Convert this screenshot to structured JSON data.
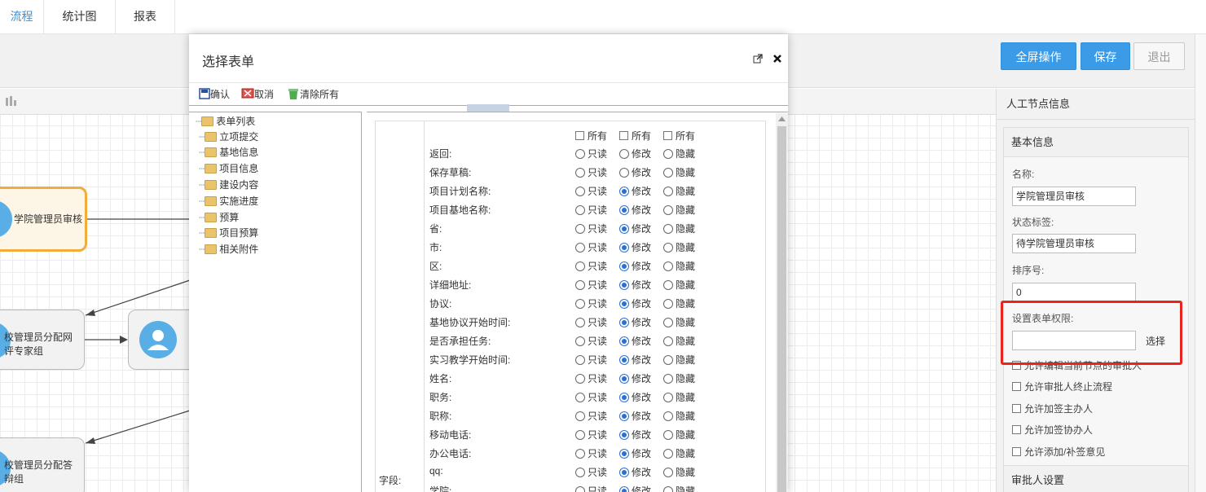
{
  "tabs": [
    "流程",
    "统计图",
    "报表"
  ],
  "toolbar": {
    "fullscreen": "全屏操作",
    "save": "保存",
    "exit": "退出"
  },
  "nodes": {
    "college": "学院管理员审核",
    "school1_line1": "校管理员分配网",
    "school1_line2": "评专家组",
    "school2_line1": "校管理员分配答",
    "school2_line2": "辩组"
  },
  "right_panel": {
    "header": "人工节点信息",
    "section": "基本信息",
    "name_label": "名称:",
    "name_value": "学院管理员审核",
    "status_label": "状态标签:",
    "status_value": "待学院管理员审核",
    "order_label": "排序号:",
    "order_value": "0",
    "perm_label": "设置表单权限:",
    "perm_value": "",
    "select_link": "选择",
    "checks": [
      "允许编辑当前节点的审批人",
      "允许审批人终止流程",
      "允许加签主办人",
      "允许加签协办人",
      "允许添加/补签意见"
    ],
    "next_section": "审批人设置"
  },
  "modal": {
    "title": "选择表单",
    "toolbar": {
      "confirm": "确认",
      "cancel": "取消",
      "clear_all": "清除所有"
    },
    "tree": [
      "表单列表",
      "立项提交",
      "基地信息",
      "项目信息",
      "建设内容",
      "实施进度",
      "预算",
      "项目预算",
      "相关附件"
    ],
    "options": {
      "readonly": "只读",
      "modify": "修改",
      "hidden": "隐藏",
      "all": "所有"
    },
    "field_group_label": "字段:",
    "fields": [
      {
        "name": "返回:",
        "sel": "none"
      },
      {
        "name": "保存草稿:",
        "sel": "none"
      },
      {
        "name": "项目计划名称:",
        "sel": "modify"
      },
      {
        "name": "项目基地名称:",
        "sel": "modify"
      },
      {
        "name": "省:",
        "sel": "modify"
      },
      {
        "name": "市:",
        "sel": "modify"
      },
      {
        "name": "区:",
        "sel": "modify"
      },
      {
        "name": "详细地址:",
        "sel": "modify"
      },
      {
        "name": "协议:",
        "sel": "modify"
      },
      {
        "name": "基地协议开始时间:",
        "sel": "modify"
      },
      {
        "name": "是否承担任务:",
        "sel": "modify"
      },
      {
        "name": "实习教学开始时间:",
        "sel": "modify"
      },
      {
        "name": "姓名:",
        "sel": "modify"
      },
      {
        "name": "职务:",
        "sel": "modify"
      },
      {
        "name": "职称:",
        "sel": "modify"
      },
      {
        "name": "移动电话:",
        "sel": "modify"
      },
      {
        "name": "办公电话:",
        "sel": "modify"
      },
      {
        "name": "qq:",
        "sel": "modify"
      },
      {
        "name": "学院:",
        "sel": "modify"
      }
    ]
  },
  "colors": {
    "primary": "#3b9be6",
    "highlight": "#e8241f",
    "selected_node": "#f0ad3c"
  }
}
